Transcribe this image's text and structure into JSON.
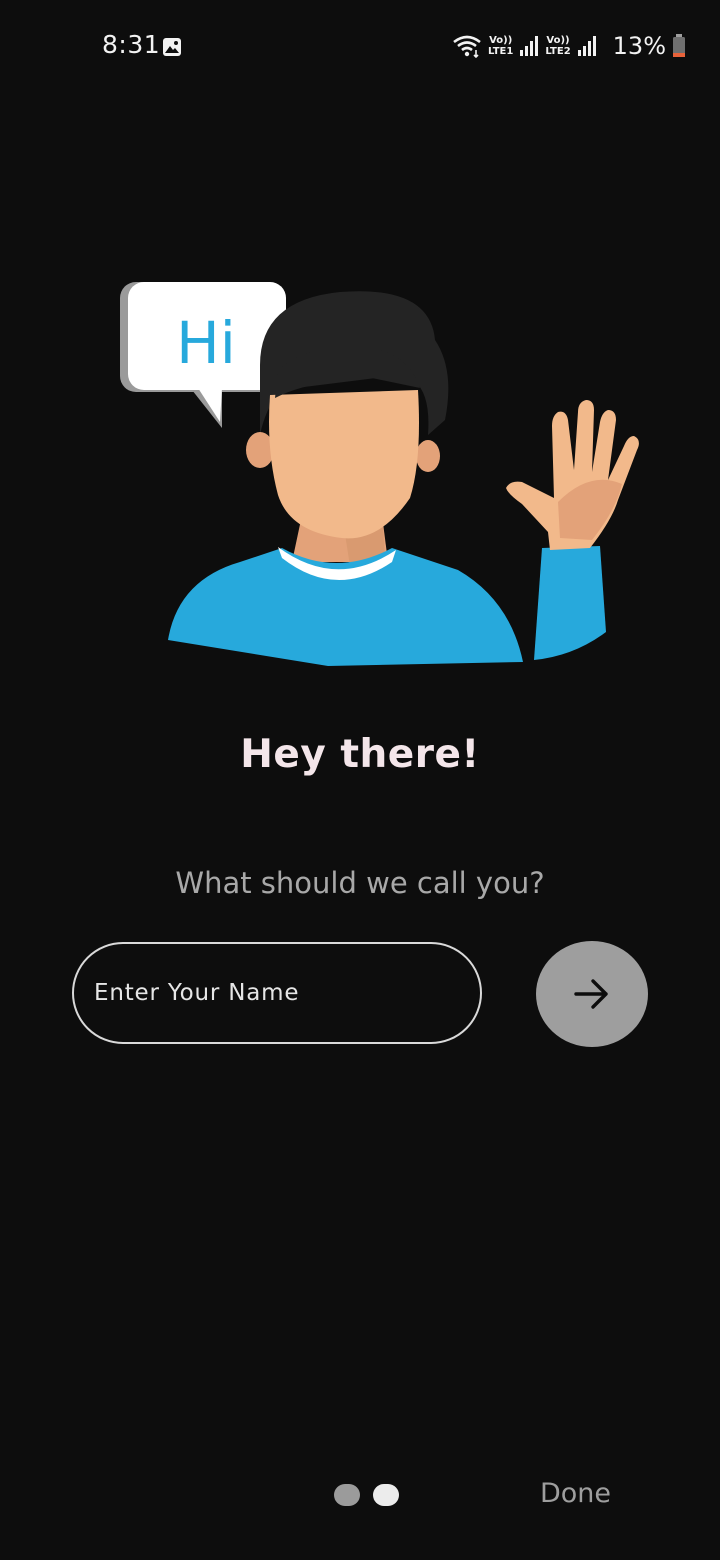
{
  "status_bar": {
    "time": "8:31",
    "battery_percent": "13%",
    "sim1_label_top": "Vo))",
    "sim1_label_bottom": "LTE1",
    "sim2_label_top": "Vo))",
    "sim2_label_bottom": "LTE2",
    "battery_level": 0.13,
    "icons": [
      "gallery-icon",
      "wifi-icon",
      "signal-icon",
      "battery-icon"
    ]
  },
  "illustration": {
    "speech_bubble_text": "Hi",
    "colors": {
      "shirt": "#27a9dc",
      "skin": "#f2b98b",
      "hair": "#242424",
      "bubble_text": "#27a9dc"
    }
  },
  "onboarding": {
    "headline": "Hey there!",
    "prompt": "What should we call you?",
    "name_input": {
      "placeholder": "Enter Your Name",
      "value": ""
    },
    "submit_icon": "arrow-right-icon"
  },
  "footer": {
    "page_count": 2,
    "active_page": 2,
    "done_label": "Done"
  }
}
